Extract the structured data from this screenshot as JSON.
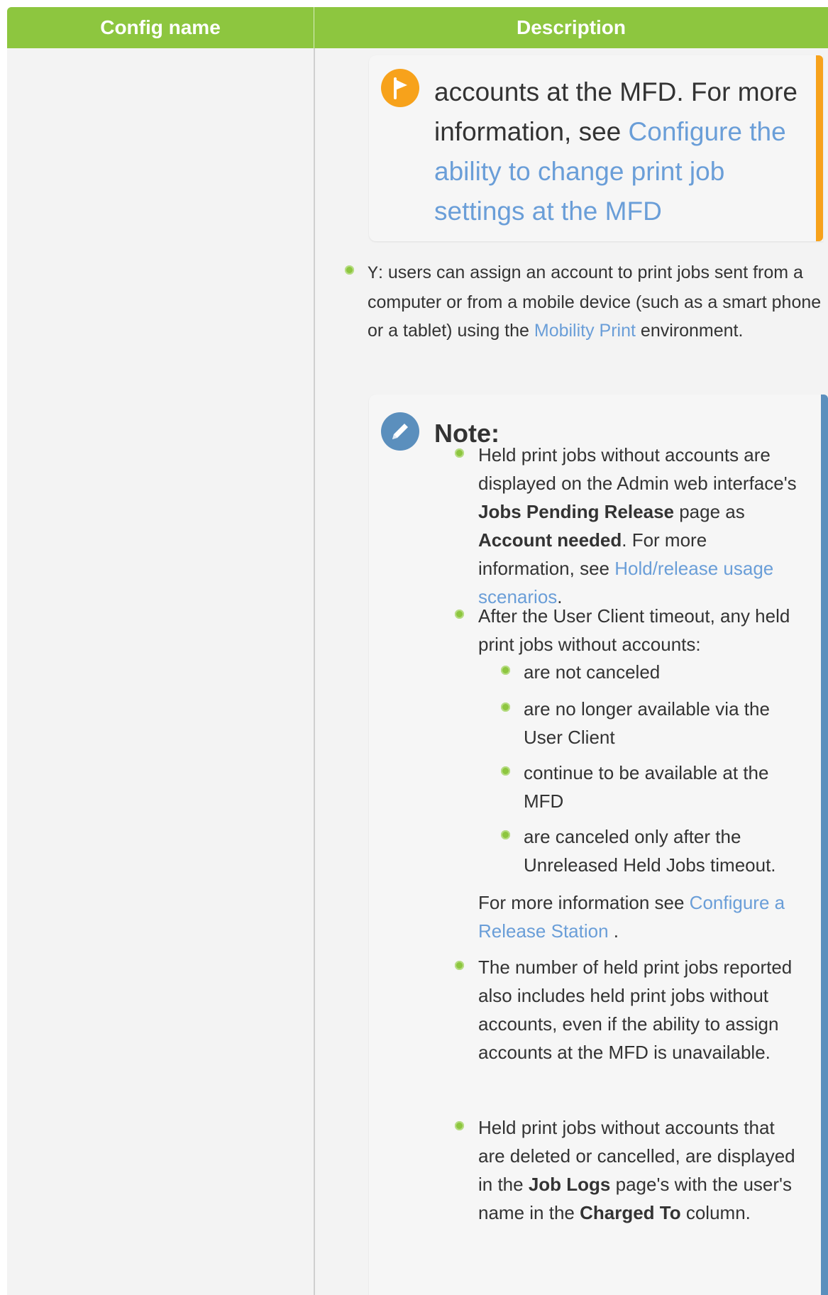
{
  "table": {
    "headers": [
      "Config name",
      "Description"
    ]
  },
  "callout_orange": {
    "line1": "accounts at the MFD. For more information, see ",
    "link": "Configure the ability to change print job settings at the MFD"
  },
  "y_bullet": {
    "code": "Y",
    "text_before": ": users can assign an account to print jobs sent from a computer or from a mobile device (such as a smart phone or a tablet) using the ",
    "link": "Mobility Print",
    "text_after": " environment."
  },
  "note": {
    "title": "Note:",
    "item1": {
      "a": "Held print jobs without accounts are displayed on the Admin web interface's ",
      "b1": "Jobs Pending Release",
      "c": " page as ",
      "b2": "Account needed",
      "d": ". For more information, see ",
      "link": "Hold/release usage scenarios",
      "e": "."
    },
    "item2": {
      "text": "After the User Client timeout, any held print jobs without accounts:",
      "sub": [
        "are not canceled",
        "are no longer available via the User Client",
        "continue to be available at the MFD",
        "are canceled only after the Unreleased Held Jobs timeout."
      ],
      "more_text": "For more information see ",
      "more_link": "Configure a Release Station",
      "more_end": " ."
    },
    "item3": "The number of held print jobs reported also includes held print jobs without accounts, even if the ability to assign accounts at the MFD is unavailable.",
    "item4": {
      "a": "Held print jobs without accounts that are deleted or cancelled, are displayed in the ",
      "b1": "Job Logs",
      "c": " page's with the user's name in the ",
      "b2": "Charged To",
      "d": " column."
    }
  },
  "colors": {
    "header_green": "#8dc63f",
    "orange_accent": "#f7a21b",
    "note_accent": "#5b8fbd",
    "link": "#6a9ed8"
  }
}
